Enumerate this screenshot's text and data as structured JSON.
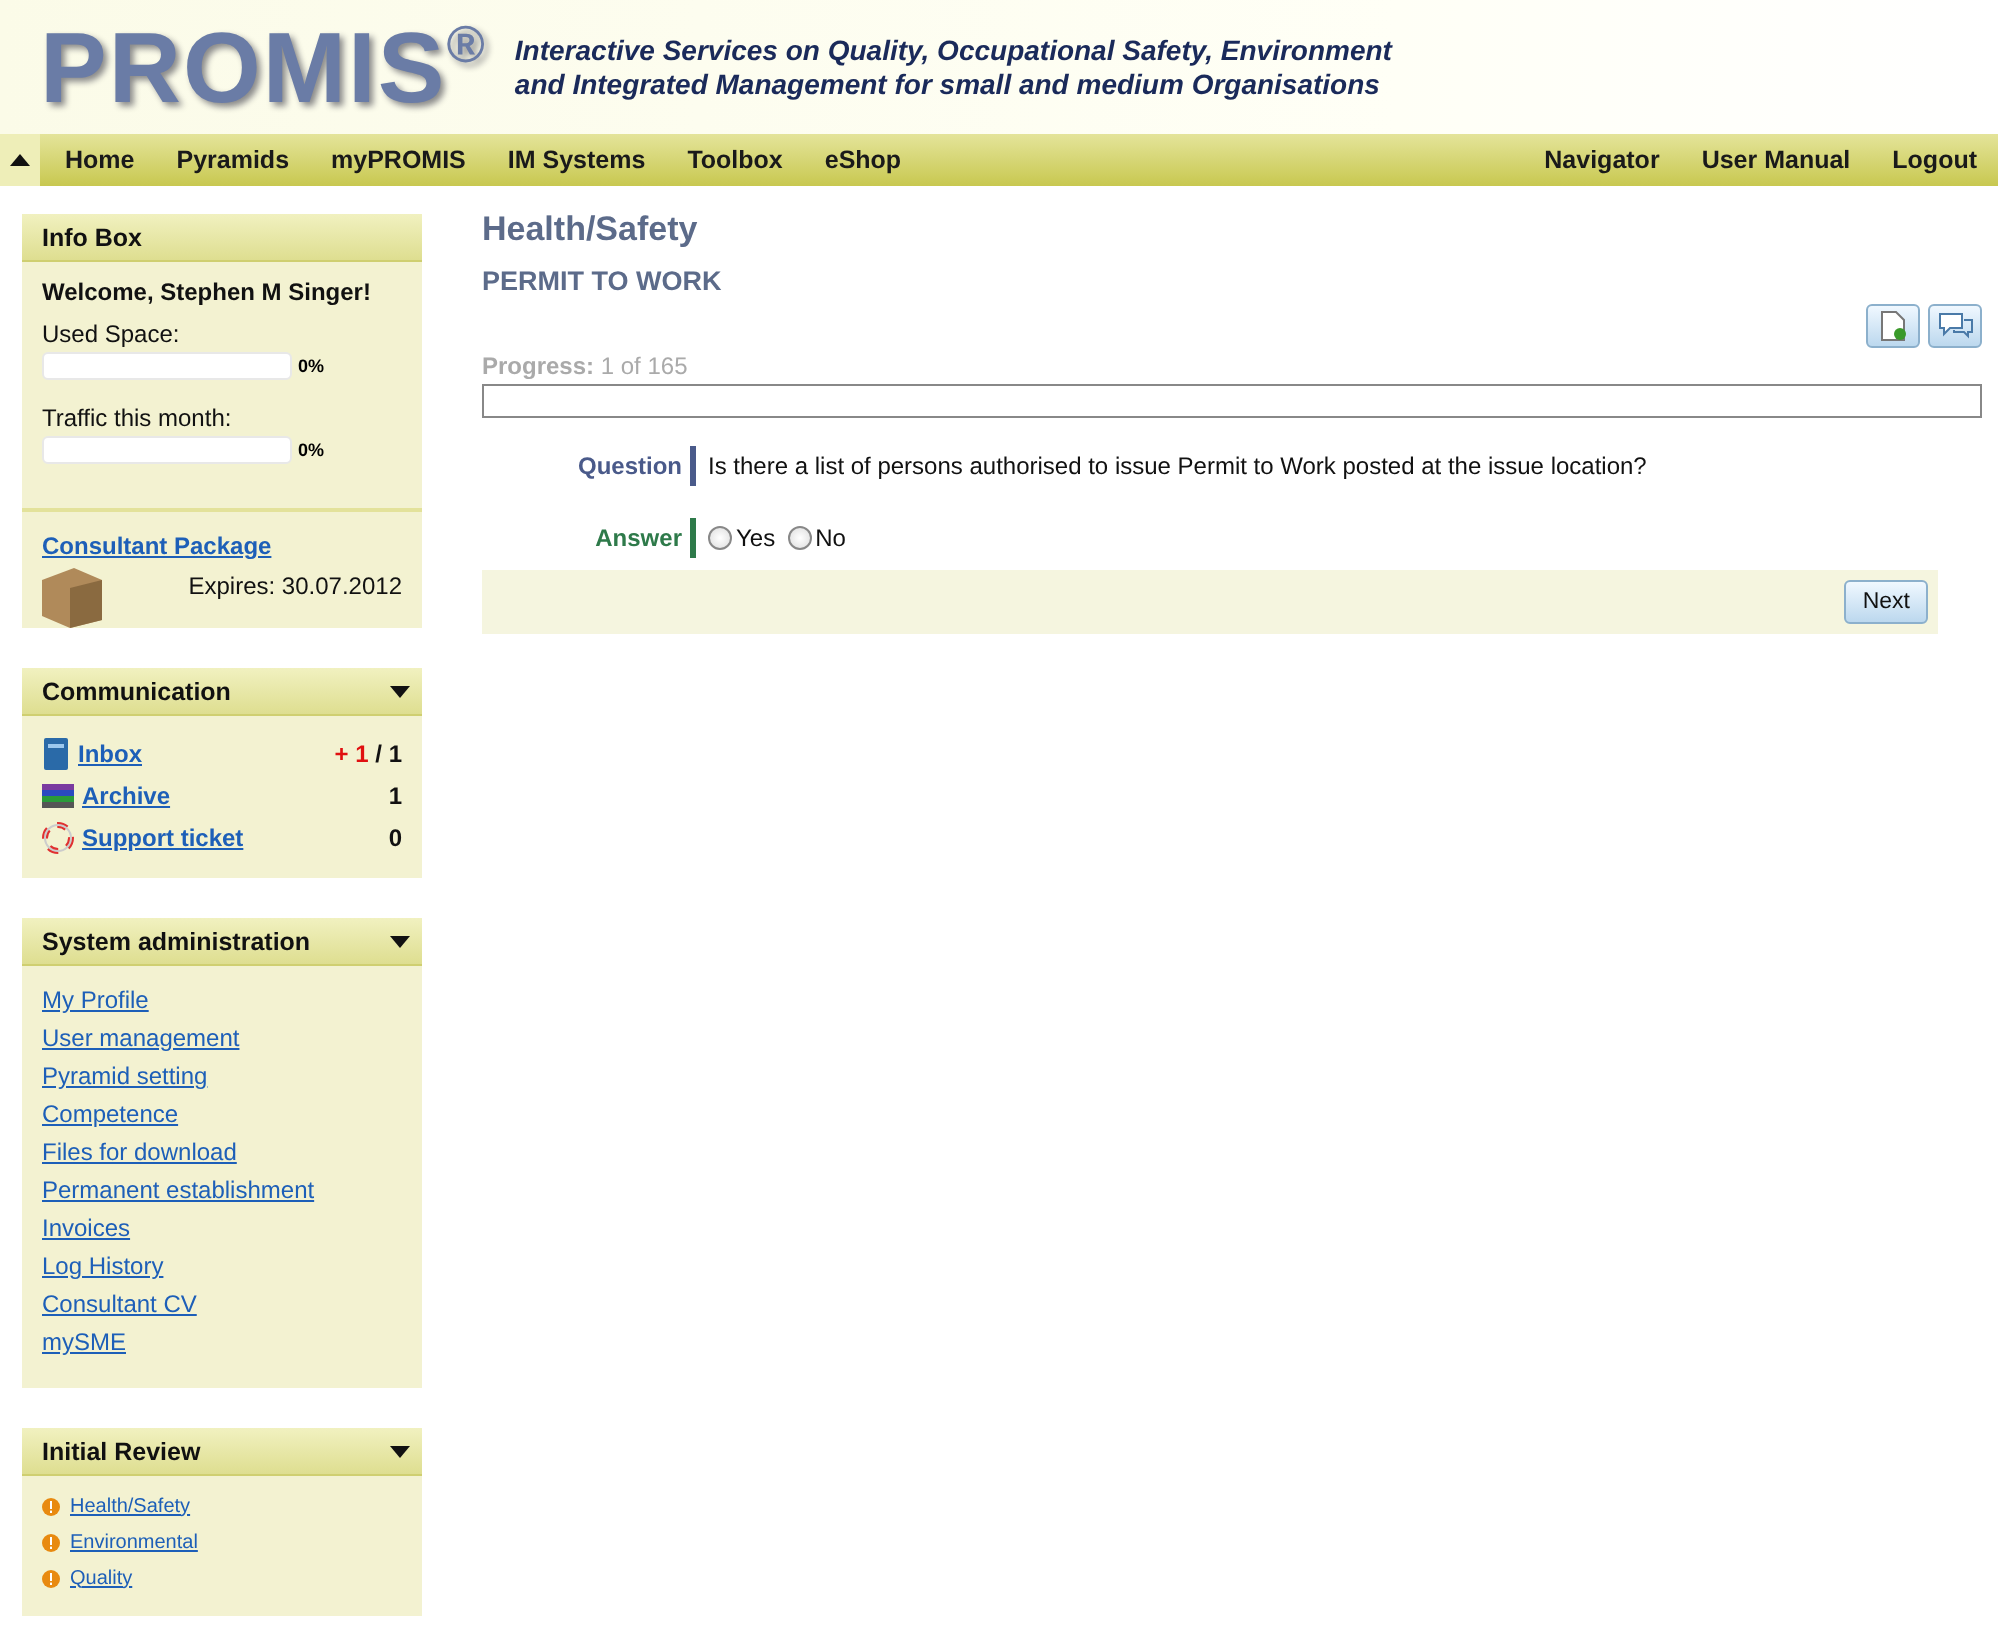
{
  "header": {
    "logo": "PROMIS",
    "logo_mark": "®",
    "tagline": [
      "Interactive Services on Quality, Occupational Safety, Environment",
      "and Integrated Management for small and medium Organisations"
    ]
  },
  "nav": {
    "left": [
      "Home",
      "Pyramids",
      "myPROMIS",
      "IM Systems",
      "Toolbox",
      "eShop"
    ],
    "right": [
      "Navigator",
      "User Manual",
      "Logout"
    ]
  },
  "info_box": {
    "title": "Info Box",
    "welcome": "Welcome, Stephen M Singer!",
    "meters": [
      {
        "label": "Used Space:",
        "level": 0,
        "reading": "0%"
      },
      {
        "label": "Traffic this month:",
        "level": 0,
        "reading": "0%"
      }
    ],
    "package": {
      "link": "Consultant Package",
      "expires": "Expires: 30.07.2012"
    }
  },
  "communication": {
    "title": "Communication",
    "items": [
      {
        "kind": "inbox",
        "label": "Inbox",
        "new": "+ 1",
        "count": "/ 1"
      },
      {
        "kind": "archive",
        "label": "Archive",
        "count": "1"
      },
      {
        "kind": "support",
        "label": "Support ticket",
        "count": "0"
      }
    ]
  },
  "system_administration": {
    "title": "System administration",
    "links": [
      "My Profile",
      "User management",
      "Pyramid setting",
      "Competence",
      "Files for download",
      "Permanent establishment",
      "Invoices",
      "Log History",
      "Consultant CV",
      "mySME"
    ]
  },
  "initial_review": {
    "title": "Initial Review",
    "links": [
      "Health/Safety",
      "Environmental",
      "Quality"
    ]
  },
  "main": {
    "title": "Health/Safety",
    "subtitle": "PERMIT TO WORK",
    "progress": {
      "label": "Progress:",
      "value": "1 of 165",
      "level": 0
    },
    "question": {
      "label": "Question",
      "text": "Is there a list of persons authorised to issue Permit to Work posted at the issue location?"
    },
    "answer": {
      "label": "Answer",
      "options": [
        {
          "label": "Yes",
          "selected": false
        },
        {
          "label": "No",
          "selected": false
        }
      ]
    },
    "next": "Next"
  }
}
